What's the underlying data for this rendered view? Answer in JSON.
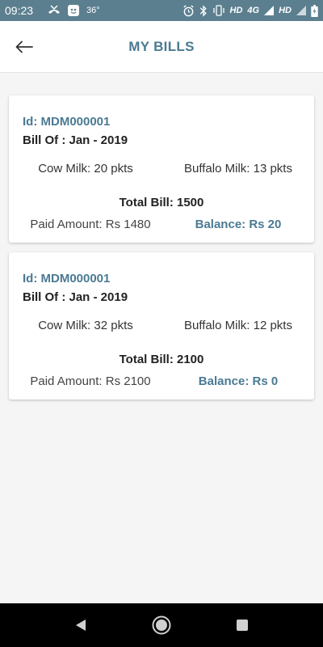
{
  "status_bar": {
    "time": "09:23",
    "temperature": "36°",
    "network_labels": [
      "HD",
      "4G",
      "HD"
    ],
    "icons": [
      "missed-call-icon",
      "app-notification-icon",
      "alarm-icon",
      "bluetooth-icon",
      "vibrate-icon",
      "signal-icon",
      "signal-icon",
      "battery-charging-icon"
    ]
  },
  "header": {
    "title": "MY BILLS",
    "back_icon": "arrow-left-icon"
  },
  "bills": [
    {
      "id": "Id: MDM000001",
      "bill_of": "Bill Of : Jan - 2019",
      "cow_milk": "Cow Milk: 20 pkts",
      "buffalo_milk": "Buffalo Milk: 13 pkts",
      "total_bill": "Total Bill: 1500",
      "paid_amount": "Paid Amount: Rs 1480",
      "balance": "Balance: Rs 20"
    },
    {
      "id": "Id: MDM000001",
      "bill_of": "Bill Of : Jan - 2019",
      "cow_milk": "Cow Milk: 32 pkts",
      "buffalo_milk": "Buffalo Milk: 12 pkts",
      "total_bill": "Total Bill: 2100",
      "paid_amount": "Paid Amount: Rs 2100",
      "balance": "Balance: Rs 0"
    }
  ],
  "nav_bar": {
    "buttons": [
      "back-triangle-icon",
      "home-circle-icon",
      "recents-square-icon"
    ]
  },
  "colors": {
    "status_bar": "#5b7f8f",
    "accent": "#4a7a93",
    "background": "#f5f5f5",
    "card": "#ffffff",
    "nav_bar": "#000000"
  }
}
